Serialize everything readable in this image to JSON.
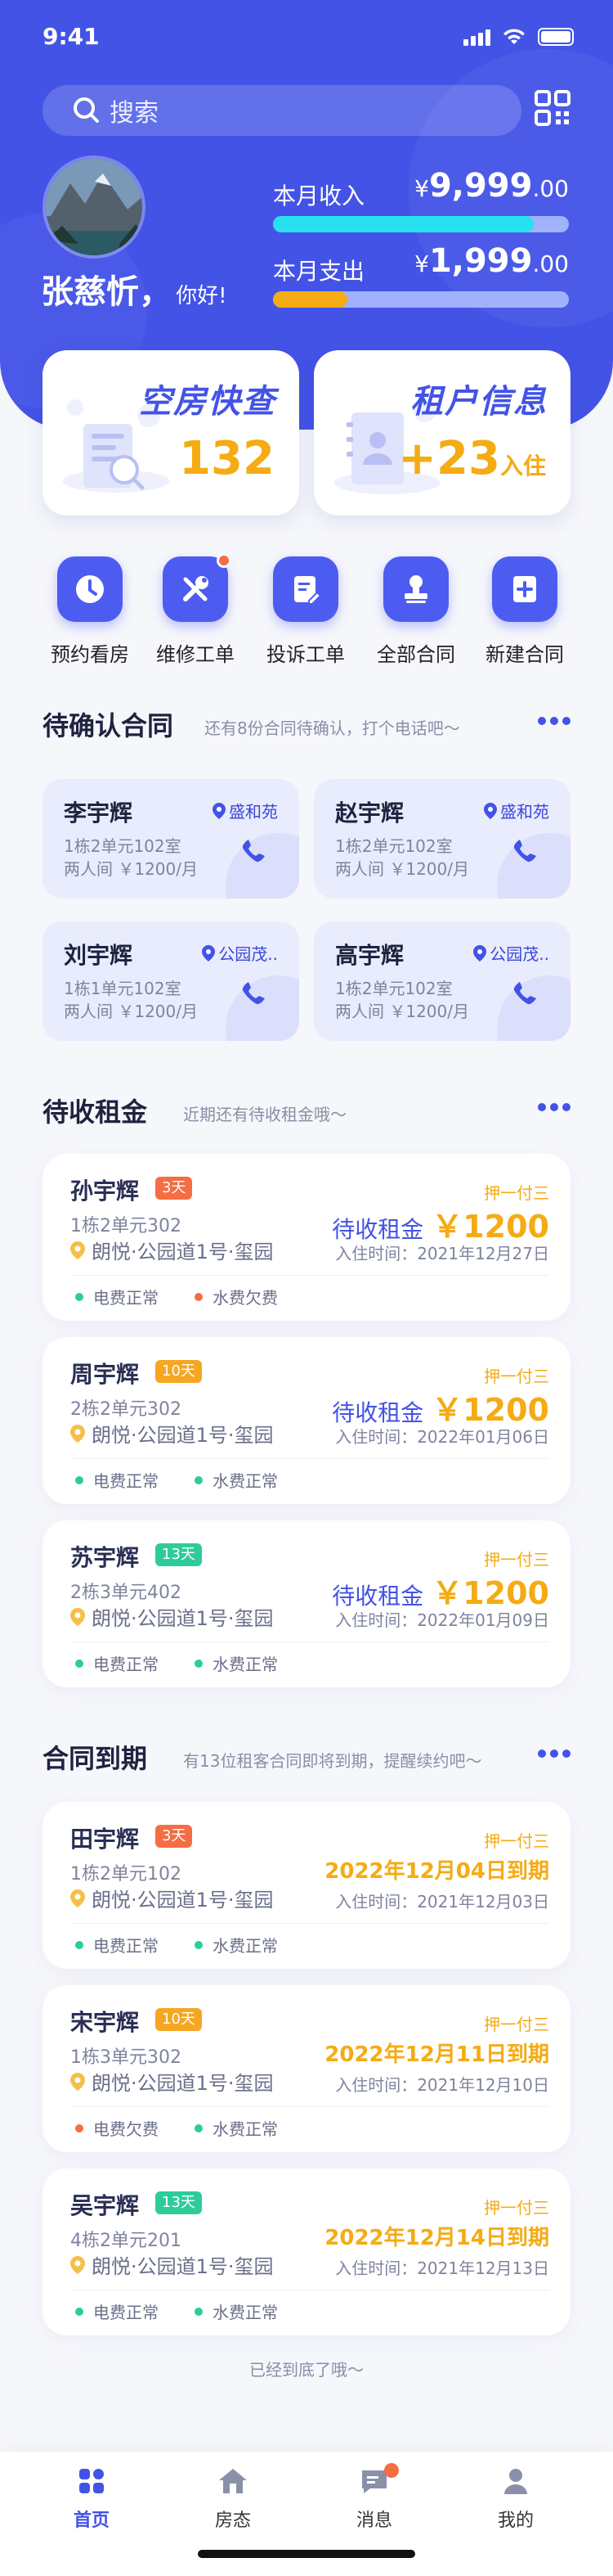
{
  "status_bar": {
    "time": "9:41"
  },
  "search": {
    "placeholder": "搜索"
  },
  "user": {
    "name": "张慈忻，",
    "greeting": "你好!"
  },
  "finance": {
    "income": {
      "label": "本月收入",
      "currency": "¥",
      "value": "9,999",
      "decimals": ".00",
      "progress": 0.88,
      "color": "#28e1ee"
    },
    "expense": {
      "label": "本月支出",
      "currency": "¥",
      "value": "1,999",
      "decimals": ".00",
      "progress": 0.25,
      "color": "#f5ab13"
    }
  },
  "quick_cards": {
    "vacant": {
      "title": "空房快查",
      "value": "132"
    },
    "tenant": {
      "title": "租户信息",
      "value": "+23",
      "unit": "入住"
    }
  },
  "actions": [
    {
      "label": "预约看房",
      "icon": "clock-icon",
      "badge": false
    },
    {
      "label": "维修工单",
      "icon": "wrench-icon",
      "badge": true
    },
    {
      "label": "投诉工单",
      "icon": "edit-document-icon",
      "badge": false
    },
    {
      "label": "全部合同",
      "icon": "stamp-icon",
      "badge": false
    },
    {
      "label": "新建合同",
      "icon": "add-document-icon",
      "badge": false
    }
  ],
  "pending_contracts": {
    "title": "待确认合同",
    "subtitle": "还有8份合同待确认，打个电话吧～",
    "items": [
      {
        "name": "李宇辉",
        "tag": "盛和苑",
        "room": "1栋2单元102室",
        "detail": "两人间  ￥1200/月"
      },
      {
        "name": "赵宇辉",
        "tag": "盛和苑",
        "room": "1栋2单元102室",
        "detail": "两人间  ￥1200/月"
      },
      {
        "name": "刘宇辉",
        "tag": "公园茂..",
        "room": "1栋1单元102室",
        "detail": "两人间  ￥1200/月"
      },
      {
        "name": "高宇辉",
        "tag": "公园茂..",
        "room": "1栋2单元102室",
        "detail": "两人间  ￥1200/月"
      }
    ]
  },
  "pending_rent": {
    "title": "待收租金",
    "subtitle": "近期还有待收租金哦～",
    "items": [
      {
        "name": "孙宇辉",
        "badge": "3天",
        "badge_color": "#f46d43",
        "room": "1栋2单元302",
        "address": "朗悦·公园道1号·玺园",
        "pay_type": "押一付三",
        "amount_label": "待收租金",
        "amount": "￥1200",
        "entry": "入住时间：2021年12月27日",
        "electric": "电费正常",
        "electric_color": "#2ecc9a",
        "water": "水费欠费",
        "water_color": "#f46d43"
      },
      {
        "name": "周宇辉",
        "badge": "10天",
        "badge_color": "#f5a623",
        "room": "2栋2单元302",
        "address": "朗悦·公园道1号·玺园",
        "pay_type": "押一付三",
        "amount_label": "待收租金",
        "amount": "￥1200",
        "entry": "入住时间：2022年01月06日",
        "electric": "电费正常",
        "electric_color": "#2ecc9a",
        "water": "水费正常",
        "water_color": "#2ecc9a"
      },
      {
        "name": "苏宇辉",
        "badge": "13天",
        "badge_color": "#2ecc9a",
        "room": "2栋3单元402",
        "address": "朗悦·公园道1号·玺园",
        "pay_type": "押一付三",
        "amount_label": "待收租金",
        "amount": "￥1200",
        "entry": "入住时间：2022年01月09日",
        "electric": "电费正常",
        "electric_color": "#2ecc9a",
        "water": "水费正常",
        "water_color": "#2ecc9a"
      }
    ]
  },
  "expiring": {
    "title": "合同到期",
    "subtitle": "有13位租客合同即将到期，提醒续约吧～",
    "items": [
      {
        "name": "田宇辉",
        "badge": "3天",
        "badge_color": "#f46d43",
        "room": "1栋2单元102",
        "address": "朗悦·公园道1号·玺园",
        "pay_type": "押一付三",
        "due": "2022年12月04日到期",
        "entry": "入住时间：2021年12月03日",
        "electric": "电费正常",
        "electric_color": "#2ecc9a",
        "water": "水费正常",
        "water_color": "#2ecc9a"
      },
      {
        "name": "宋宇辉",
        "badge": "10天",
        "badge_color": "#f5a623",
        "room": "1栋3单元302",
        "address": "朗悦·公园道1号·玺园",
        "pay_type": "押一付三",
        "due": "2022年12月11日到期",
        "entry": "入住时间：2021年12月10日",
        "electric": "电费欠费",
        "electric_color": "#f46d43",
        "water": "水费正常",
        "water_color": "#2ecc9a"
      },
      {
        "name": "吴宇辉",
        "badge": "13天",
        "badge_color": "#2ecc9a",
        "room": "4栋2单元201",
        "address": "朗悦·公园道1号·玺园",
        "pay_type": "押一付三",
        "due": "2022年12月14日到期",
        "entry": "入住时间：2021年12月13日",
        "electric": "电费正常",
        "electric_color": "#2ecc9a",
        "water": "水费正常",
        "water_color": "#2ecc9a"
      }
    ]
  },
  "end_text": "已经到底了哦～",
  "tabs": [
    {
      "label": "首页",
      "icon": "grid-home-icon",
      "active": true,
      "badge": false
    },
    {
      "label": "房态",
      "icon": "house-icon",
      "active": false,
      "badge": false
    },
    {
      "label": "消息",
      "icon": "message-icon",
      "active": false,
      "badge": true
    },
    {
      "label": "我的",
      "icon": "user-icon",
      "active": false,
      "badge": false
    }
  ]
}
